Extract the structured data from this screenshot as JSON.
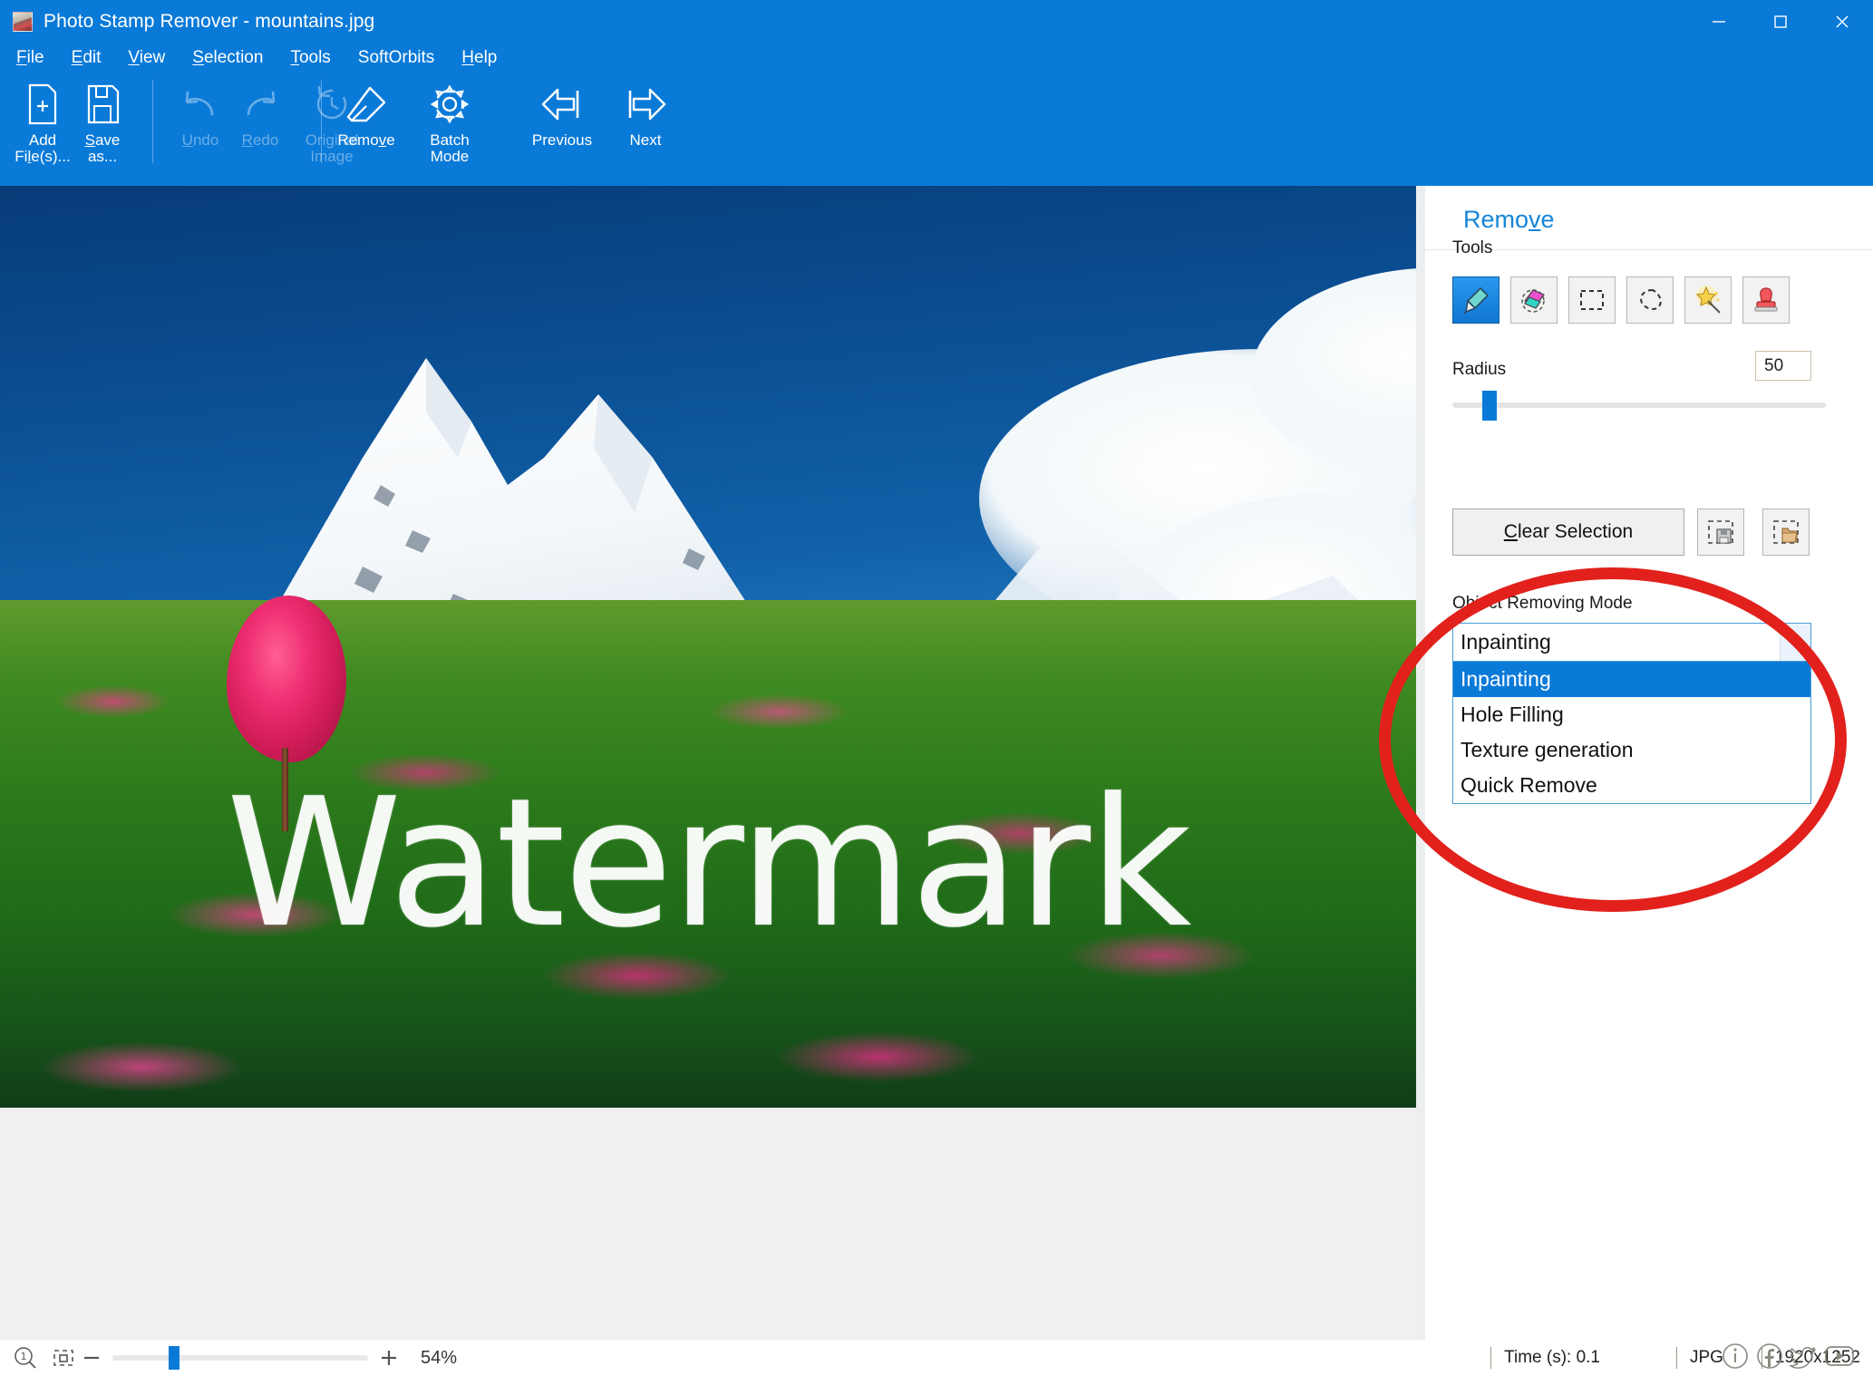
{
  "window": {
    "title": "Photo Stamp Remover - mountains.jpg",
    "app_icon": "app-icon",
    "minimize": "minimize-icon",
    "maximize": "maximize-icon",
    "close": "close-icon",
    "titlebar_color": "#0a7ad8"
  },
  "menu": [
    {
      "pre": "",
      "key": "F",
      "post": "ile"
    },
    {
      "pre": "",
      "key": "E",
      "post": "dit"
    },
    {
      "pre": "",
      "key": "V",
      "post": "iew"
    },
    {
      "pre": "",
      "key": "S",
      "post": "election"
    },
    {
      "pre": "",
      "key": "T",
      "post": "ools"
    },
    {
      "pre": "SoftOrbits",
      "key": "",
      "post": ""
    },
    {
      "pre": "",
      "key": "H",
      "post": "elp"
    }
  ],
  "toolbar": {
    "add_files": {
      "line1": "Add",
      "line2_pre": "Fi",
      "line2_key": "l",
      "line2_post": "e(s)...",
      "icon": "add-file-icon",
      "disabled": false
    },
    "save_as": {
      "line1_pre": "",
      "line1_key": "S",
      "line1_post": "ave",
      "line2": "as...",
      "icon": "save-icon",
      "disabled": false
    },
    "undo": {
      "label_pre": "",
      "label_key": "U",
      "label_post": "ndo",
      "icon": "undo-icon",
      "disabled": true
    },
    "redo": {
      "label_pre": "",
      "label_key": "R",
      "label_post": "edo",
      "icon": "redo-icon",
      "disabled": true
    },
    "original_image": {
      "line1": "Original",
      "line2": "Image",
      "icon": "history-icon",
      "disabled": true
    },
    "remove": {
      "label_pre": "Remo",
      "label_key": "v",
      "label_post": "e",
      "icon": "eraser-icon",
      "disabled": false
    },
    "batch_mode": {
      "line1": "Batch",
      "line2": "Mode",
      "icon": "gear-icon",
      "disabled": false
    },
    "previous": {
      "label": "Previous",
      "icon": "arrow-left-icon",
      "disabled": false
    },
    "next": {
      "label": "Next",
      "icon": "arrow-right-icon",
      "disabled": false
    }
  },
  "panel": {
    "heading_pre": "Remo",
    "heading_key": "v",
    "heading_post": "e",
    "tools_label": "Tools",
    "tools": [
      {
        "name": "marker-tool",
        "selected": true
      },
      {
        "name": "eraser-tool",
        "selected": false
      },
      {
        "name": "rectangle-select-tool",
        "selected": false
      },
      {
        "name": "lasso-select-tool",
        "selected": false
      },
      {
        "name": "magic-wand-tool",
        "selected": false
      },
      {
        "name": "stamp-tool",
        "selected": false
      }
    ],
    "radius_label": "Radius",
    "radius_value": "50",
    "clear_selection": {
      "pre": "",
      "key": "C",
      "post": "lear Selection"
    },
    "save_selection_icon": "save-selection-icon",
    "load_selection_icon": "load-selection-icon",
    "object_removing_mode_label": "Object Removing Mode",
    "combo_value": "Inpainting",
    "combo_options": [
      {
        "label": "Inpainting",
        "selected": true
      },
      {
        "label": "Hole Filling",
        "selected": false
      },
      {
        "label": "Texture generation",
        "selected": false
      },
      {
        "label": "Quick Remove",
        "selected": false
      }
    ],
    "accent_color": "#0a7ad8",
    "highlight_color": "#e2211c"
  },
  "canvas": {
    "watermark_text": "Watermark"
  },
  "statusbar": {
    "zoom_fit_icon": "zoom-fit-icon",
    "fit_screen_icon": "fit-to-screen-icon",
    "minus": "minus-icon",
    "plus": "plus-icon",
    "zoom_percent": "54%",
    "time": "Time (s): 0.1",
    "format": "JPG",
    "dimensions": "1920x1252",
    "social": [
      {
        "name": "info-icon"
      },
      {
        "name": "facebook-icon"
      },
      {
        "name": "twitter-icon"
      },
      {
        "name": "youtube-icon"
      }
    ]
  }
}
